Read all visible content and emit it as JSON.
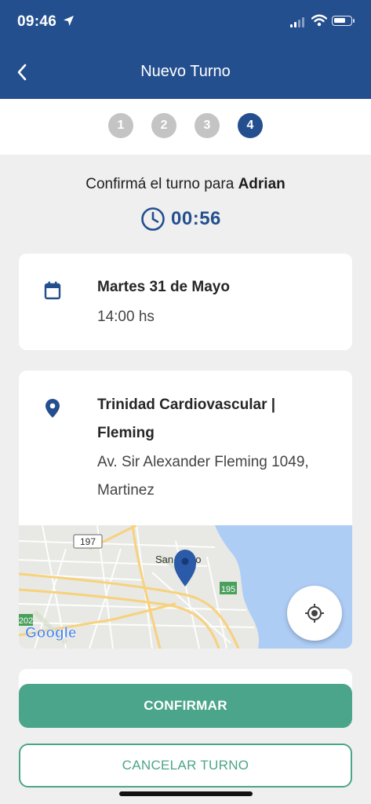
{
  "status_bar": {
    "time": "09:46",
    "battery_level": 0.75
  },
  "header": {
    "title": "Nuevo Turno",
    "back_icon": "chevron-left-icon"
  },
  "steps": [
    {
      "label": "1",
      "active": false
    },
    {
      "label": "2",
      "active": false
    },
    {
      "label": "3",
      "active": false
    },
    {
      "label": "4",
      "active": true
    }
  ],
  "confirmation": {
    "prefix": "Confirmá el turno para ",
    "patient": "Adrian"
  },
  "timer": {
    "value": "00:56",
    "icon": "clock-icon"
  },
  "appointment": {
    "date": "Martes 31 de Mayo",
    "time": "14:00 hs",
    "icon": "calendar-icon"
  },
  "location": {
    "name_line1": "Trinidad Cardiovascular |",
    "name_line2": "Fleming",
    "address_line1": "Av. Sir Alexander Fleming 1049,",
    "address_line2": "Martinez",
    "icon": "map-pin-icon"
  },
  "map": {
    "route_labels": [
      "197",
      "195",
      "202"
    ],
    "place_label": "San Isidro",
    "provider": "Google"
  },
  "actions": {
    "confirm": "CONFIRMAR",
    "cancel": "CANCELAR TURNO"
  },
  "colors": {
    "primary": "#244f8e",
    "accent": "#4ba58a",
    "background": "#efefef",
    "step_inactive": "#c4c4c4"
  }
}
